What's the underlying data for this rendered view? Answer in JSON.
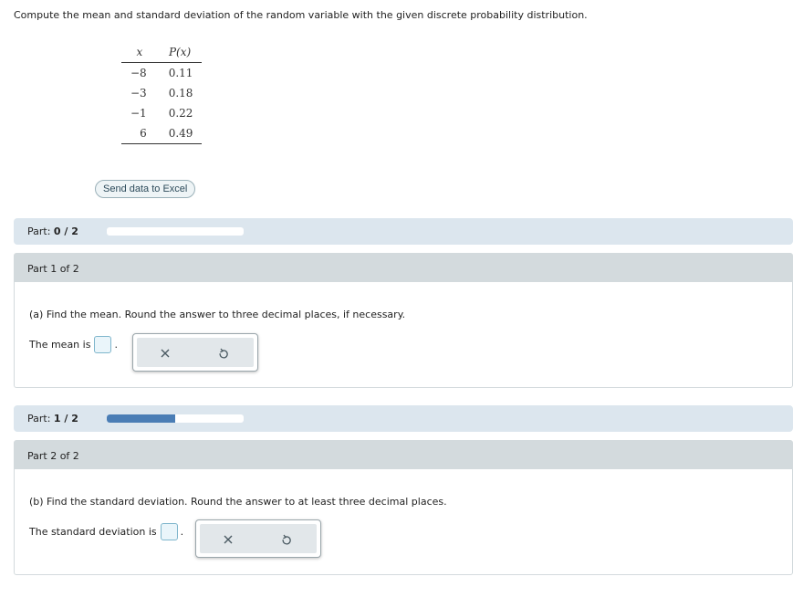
{
  "prompt": "Compute the mean and standard deviation of the random variable with the given discrete probability distribution.",
  "table": {
    "headers": [
      "x",
      "P(x)"
    ],
    "rows": [
      {
        "x": "−8",
        "p": "0.11"
      },
      {
        "x": "−3",
        "p": "0.18"
      },
      {
        "x": "−1",
        "p": "0.22"
      },
      {
        "x": "6",
        "p": "0.49"
      }
    ]
  },
  "excel_button": "Send data to Excel",
  "parts": [
    {
      "progress_label": "Part:",
      "progress_value": "0 / 2",
      "progress_fraction": 0.0,
      "header": "Part 1 of 2",
      "question": "(a) Find the mean. Round the answer to three decimal places, if necessary.",
      "answer_prefix": "The mean is",
      "answer_value": "",
      "answer_suffix": "."
    },
    {
      "progress_label": "Part:",
      "progress_value": "1 / 2",
      "progress_fraction": 0.5,
      "header": "Part 2 of 2",
      "question": "(b) Find the standard deviation. Round the answer to at least three decimal places.",
      "answer_prefix": "The standard deviation is",
      "answer_value": "",
      "answer_suffix": "."
    }
  ],
  "tools": {
    "clear_icon": "x-icon",
    "undo_icon": "undo-icon"
  },
  "colors": {
    "progress_fill": "#4a7db5",
    "part_bar_bg": "#dce6ee",
    "part_header_bg": "#d3dadd"
  }
}
